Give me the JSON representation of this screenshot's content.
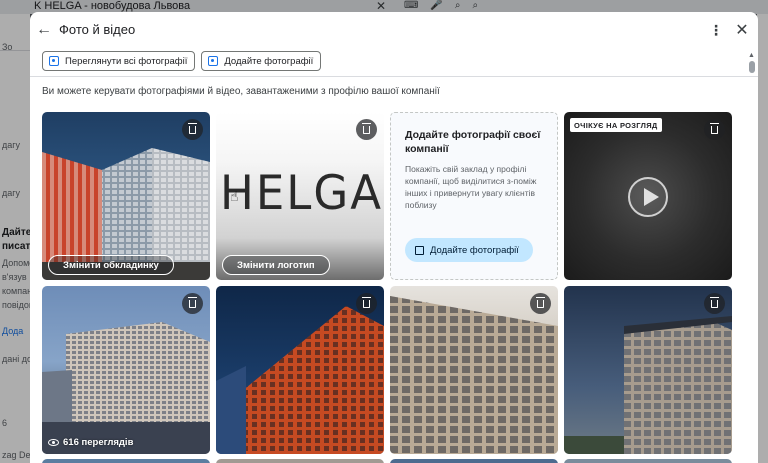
{
  "background": {
    "title": "K HELGA - новобудова Львова",
    "left_fragments": [
      "Зо",
      "дагу",
      "дагу",
      "Дайте",
      "писат",
      "Допомо",
      "в'язув",
      "компан",
      "повідом",
      "Дода",
      "дані до",
      "6",
      "zag Devi"
    ]
  },
  "dialog": {
    "title": "Фото й відео",
    "toolbar": {
      "view_all": "Переглянути всі фотографії",
      "add_photos": "Додайте фотографії"
    },
    "intro": "Ви можете керувати фотографіями й відео, завантаженими з профілю вашої компанії"
  },
  "tiles": {
    "cover": {
      "button": "Змінити обкладинку"
    },
    "logo": {
      "logo_text": "HELGA",
      "button": "Змінити логотип"
    },
    "add_card": {
      "title": "Додайте фотографії своєї компанії",
      "description": "Покажіть свій заклад у профілі компанії, щоб виділитися з-поміж інших і привернути увагу клієнтів поблизу",
      "button": "Додайте фотографії"
    },
    "video": {
      "badge": "ОЧІКУЄ НА РОЗГЛЯД"
    },
    "photo1": {
      "views": "616 переглядів"
    }
  },
  "colors": {
    "accent": "#1a73e8",
    "add_button_bg": "#c2e7ff",
    "divider": "#dadce0"
  },
  "icons": [
    "arrow-back-icon",
    "more-vert-icon",
    "close-icon",
    "photo-library-icon",
    "add-photo-icon",
    "trash-icon",
    "play-icon",
    "eye-icon"
  ]
}
